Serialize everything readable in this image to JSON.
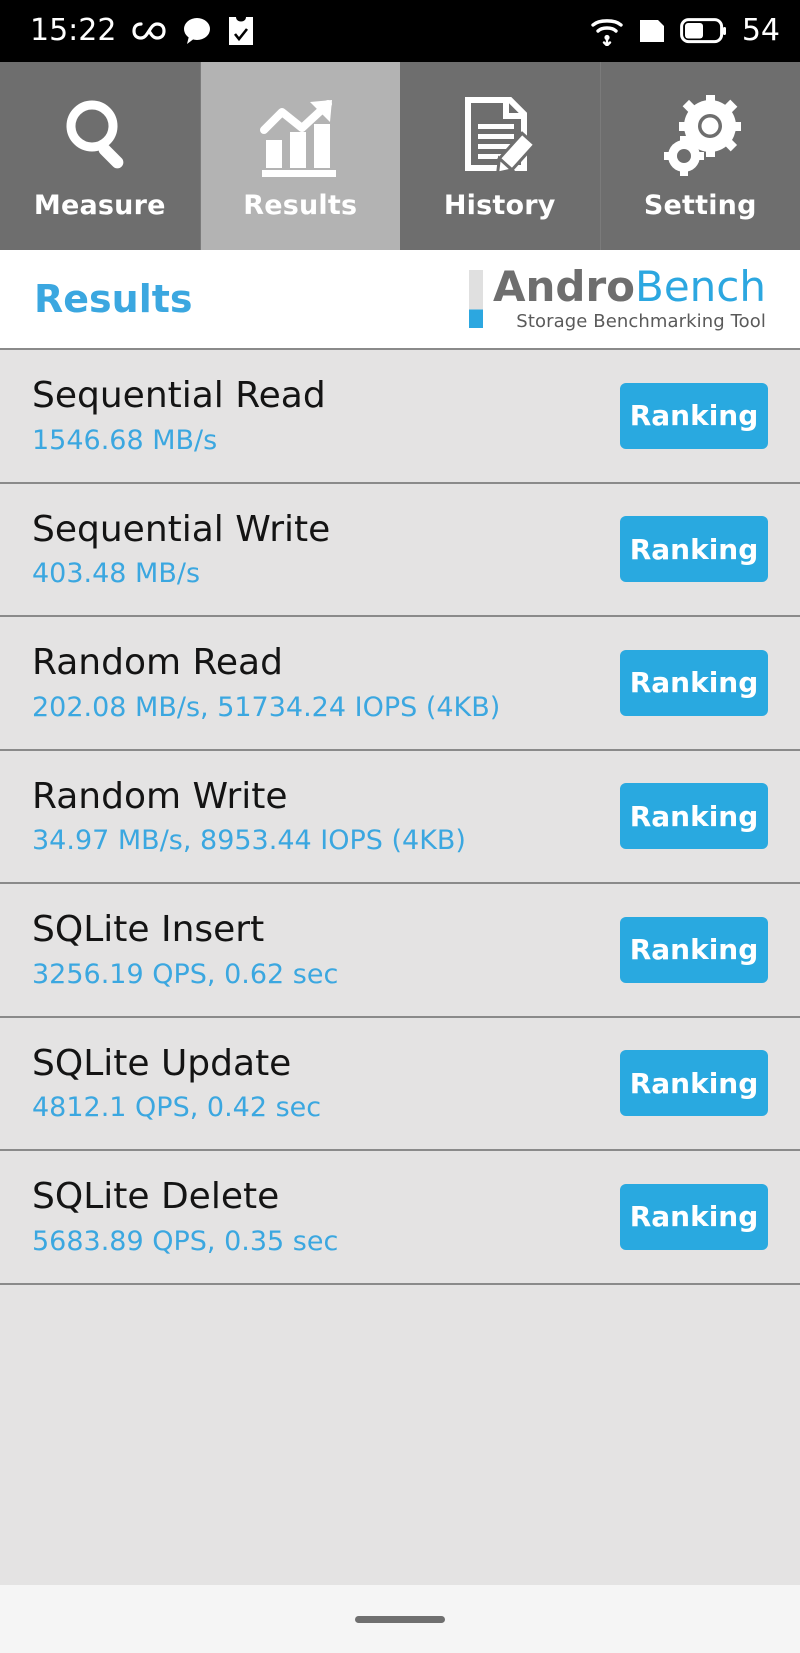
{
  "statusbar": {
    "time": "15:22",
    "battery_percent": "54",
    "icons": {
      "infinity": "infinity-icon",
      "message": "message-bubble-icon",
      "task": "task-checklist-icon",
      "wifi": "wifi-download-icon",
      "sim": "sim-card-icon",
      "battery": "battery-icon"
    }
  },
  "tabs": [
    {
      "label": "Measure",
      "icon": "magnifier-icon",
      "active": false
    },
    {
      "label": "Results",
      "icon": "bar-chart-arrow-icon",
      "active": true
    },
    {
      "label": "History",
      "icon": "document-pencil-icon",
      "active": false
    },
    {
      "label": "Setting",
      "icon": "gears-icon",
      "active": false
    }
  ],
  "header": {
    "title": "Results",
    "brand_primary": "Andro",
    "brand_secondary": "Bench",
    "brand_tagline": "Storage Benchmarking Tool"
  },
  "colors": {
    "accent_blue": "#29a9e0",
    "title_blue": "#3ba7e0",
    "tab_inactive": "#6e6e6e",
    "tab_active": "#b3b3b3",
    "list_bg": "#e4e3e3",
    "divider": "#8a8a8a"
  },
  "results": {
    "ranking_label": "Ranking",
    "rows": [
      {
        "name": "Sequential Read",
        "value": "1546.68 MB/s"
      },
      {
        "name": "Sequential Write",
        "value": "403.48 MB/s"
      },
      {
        "name": "Random Read",
        "value": "202.08 MB/s, 51734.24 IOPS (4KB)"
      },
      {
        "name": "Random Write",
        "value": "34.97 MB/s, 8953.44 IOPS (4KB)"
      },
      {
        "name": "SQLite Insert",
        "value": "3256.19 QPS, 0.62 sec"
      },
      {
        "name": "SQLite Update",
        "value": "4812.1 QPS, 0.42 sec"
      },
      {
        "name": "SQLite Delete",
        "value": "5683.89 QPS, 0.35 sec"
      }
    ]
  },
  "navbar": {
    "gesture_handle": "home-gesture-pill"
  }
}
